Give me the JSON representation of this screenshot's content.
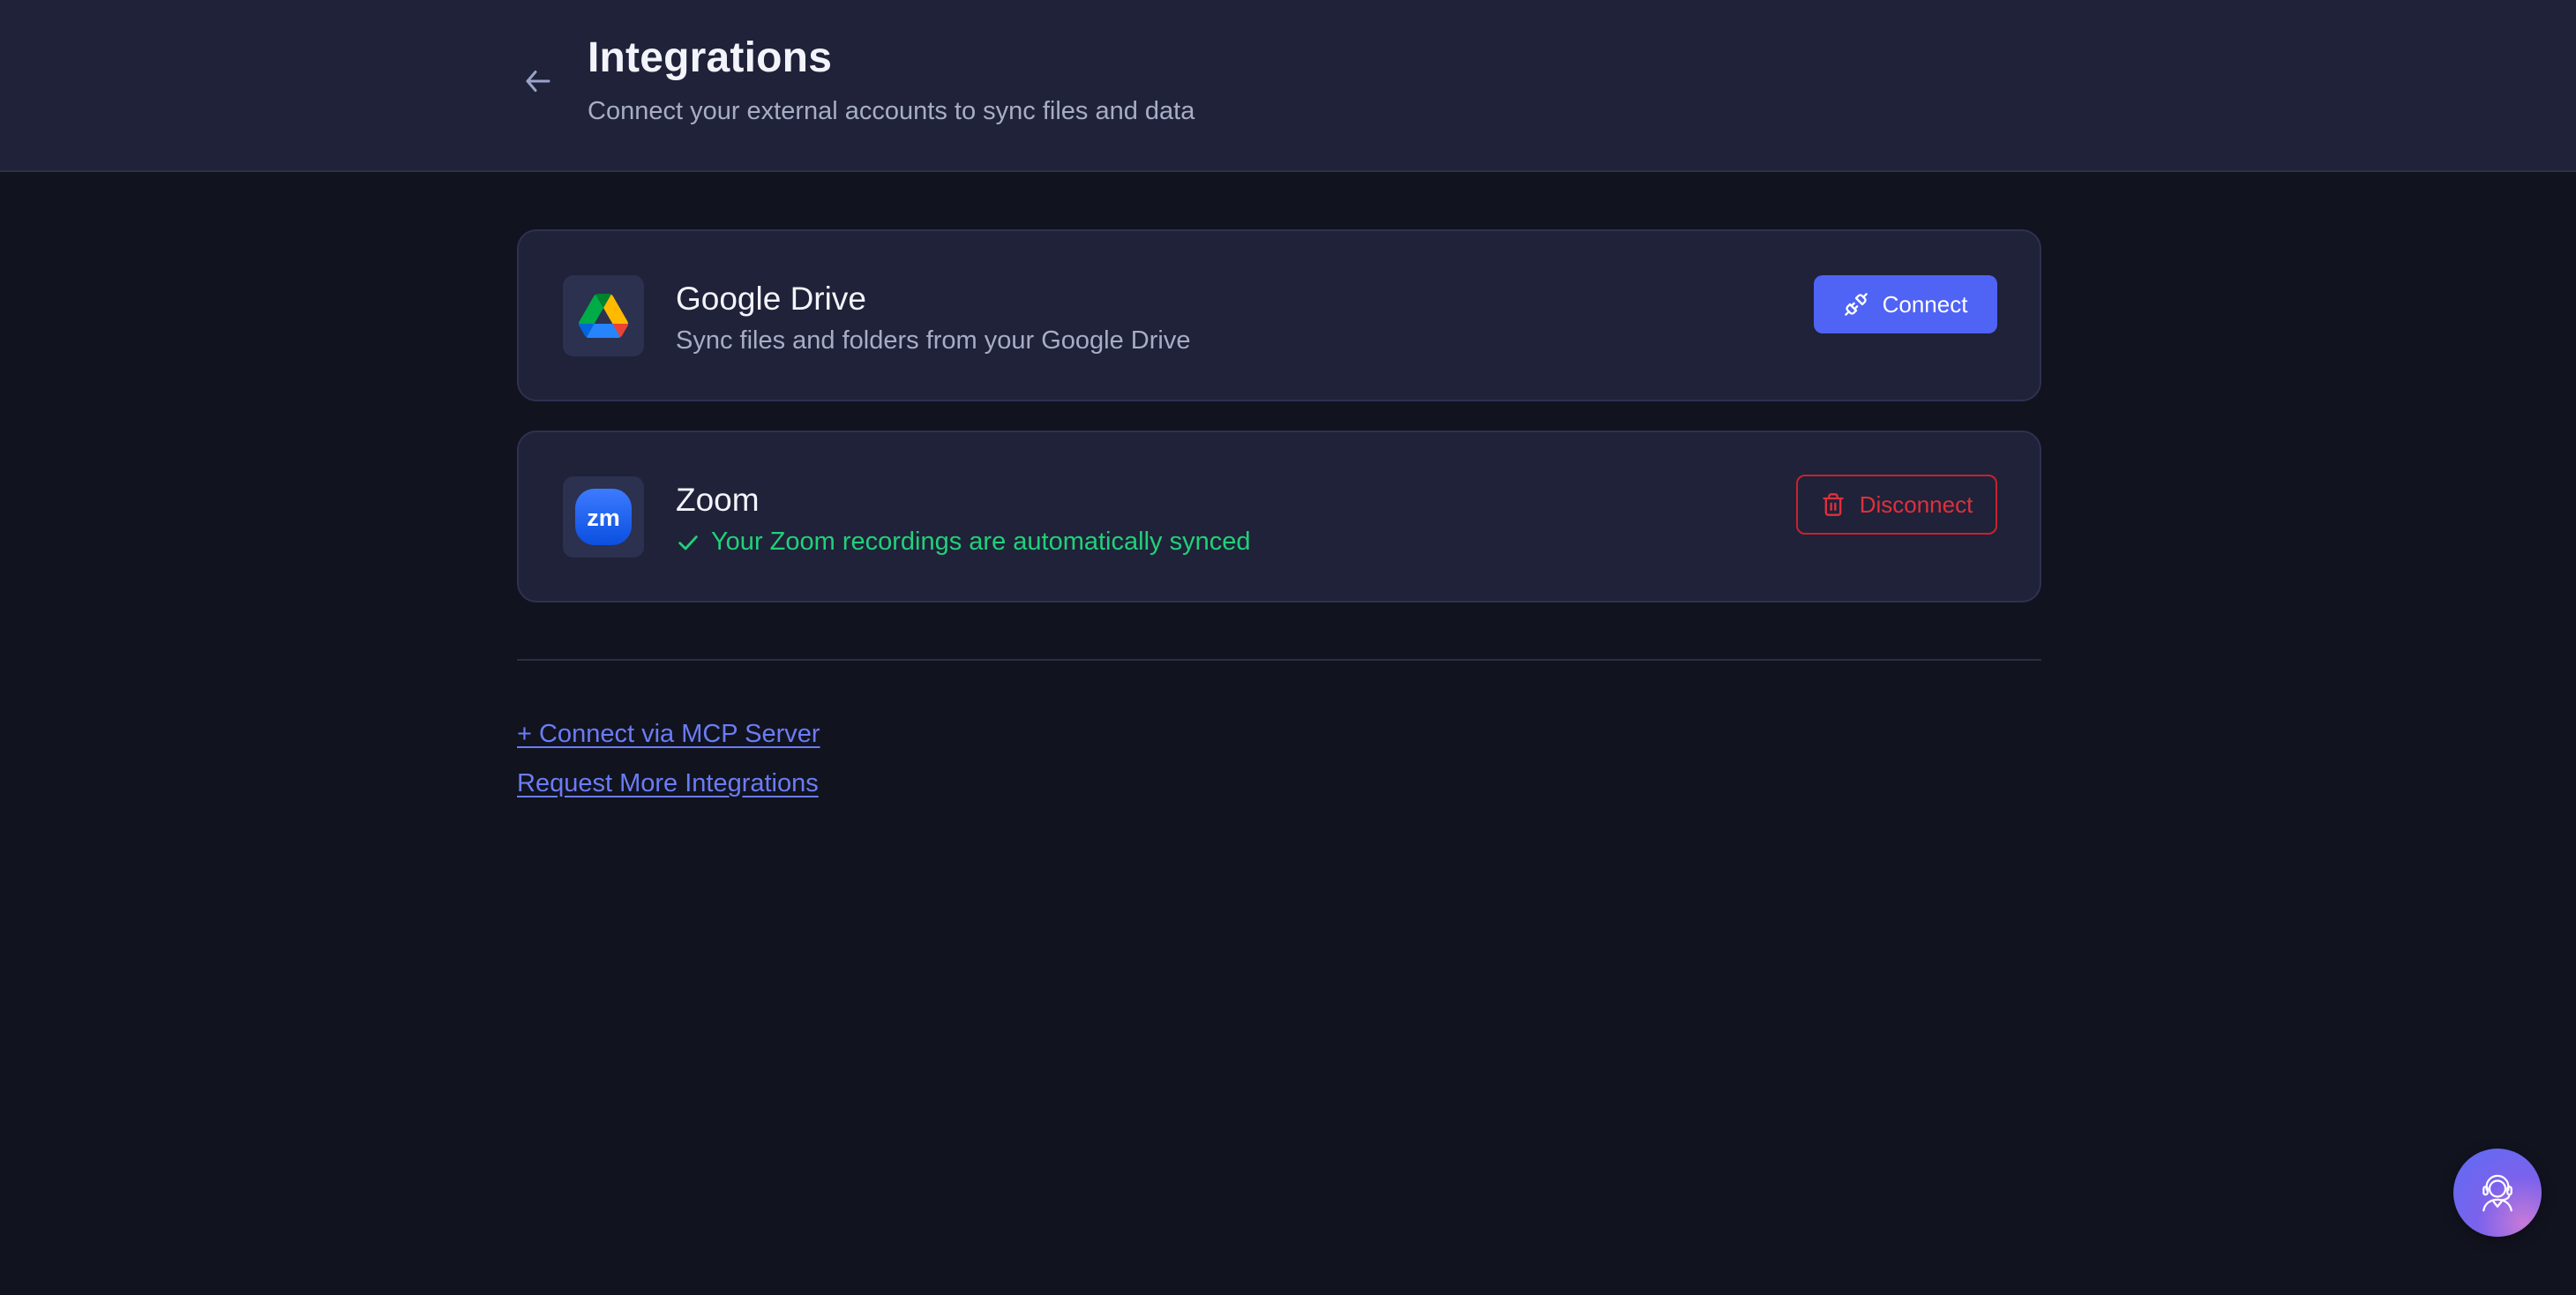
{
  "header": {
    "title": "Integrations",
    "subtitle": "Connect your external accounts to sync files and data"
  },
  "integrations": [
    {
      "name": "Google Drive",
      "description": "Sync files and folders from your Google Drive",
      "icon": "google-drive-logo",
      "action_label": "Connect",
      "action_icon": "plug-icon",
      "connected": false
    },
    {
      "name": "Zoom",
      "status": "Your Zoom recordings are automatically synced",
      "status_icon": "check-icon",
      "icon": "zoom-logo",
      "logo_text": "zm",
      "action_label": "Disconnect",
      "action_icon": "trash-icon",
      "connected": true
    }
  ],
  "links": {
    "mcp": "+ Connect via MCP Server",
    "request": "Request More Integrations"
  },
  "colors": {
    "background": "#11131f",
    "surface": "#1f2238",
    "accent": "#4f63f5",
    "link": "#6b7cf6",
    "success": "#22d07a",
    "danger": "#e0303c"
  },
  "support": {
    "icon": "support-agent-icon"
  }
}
